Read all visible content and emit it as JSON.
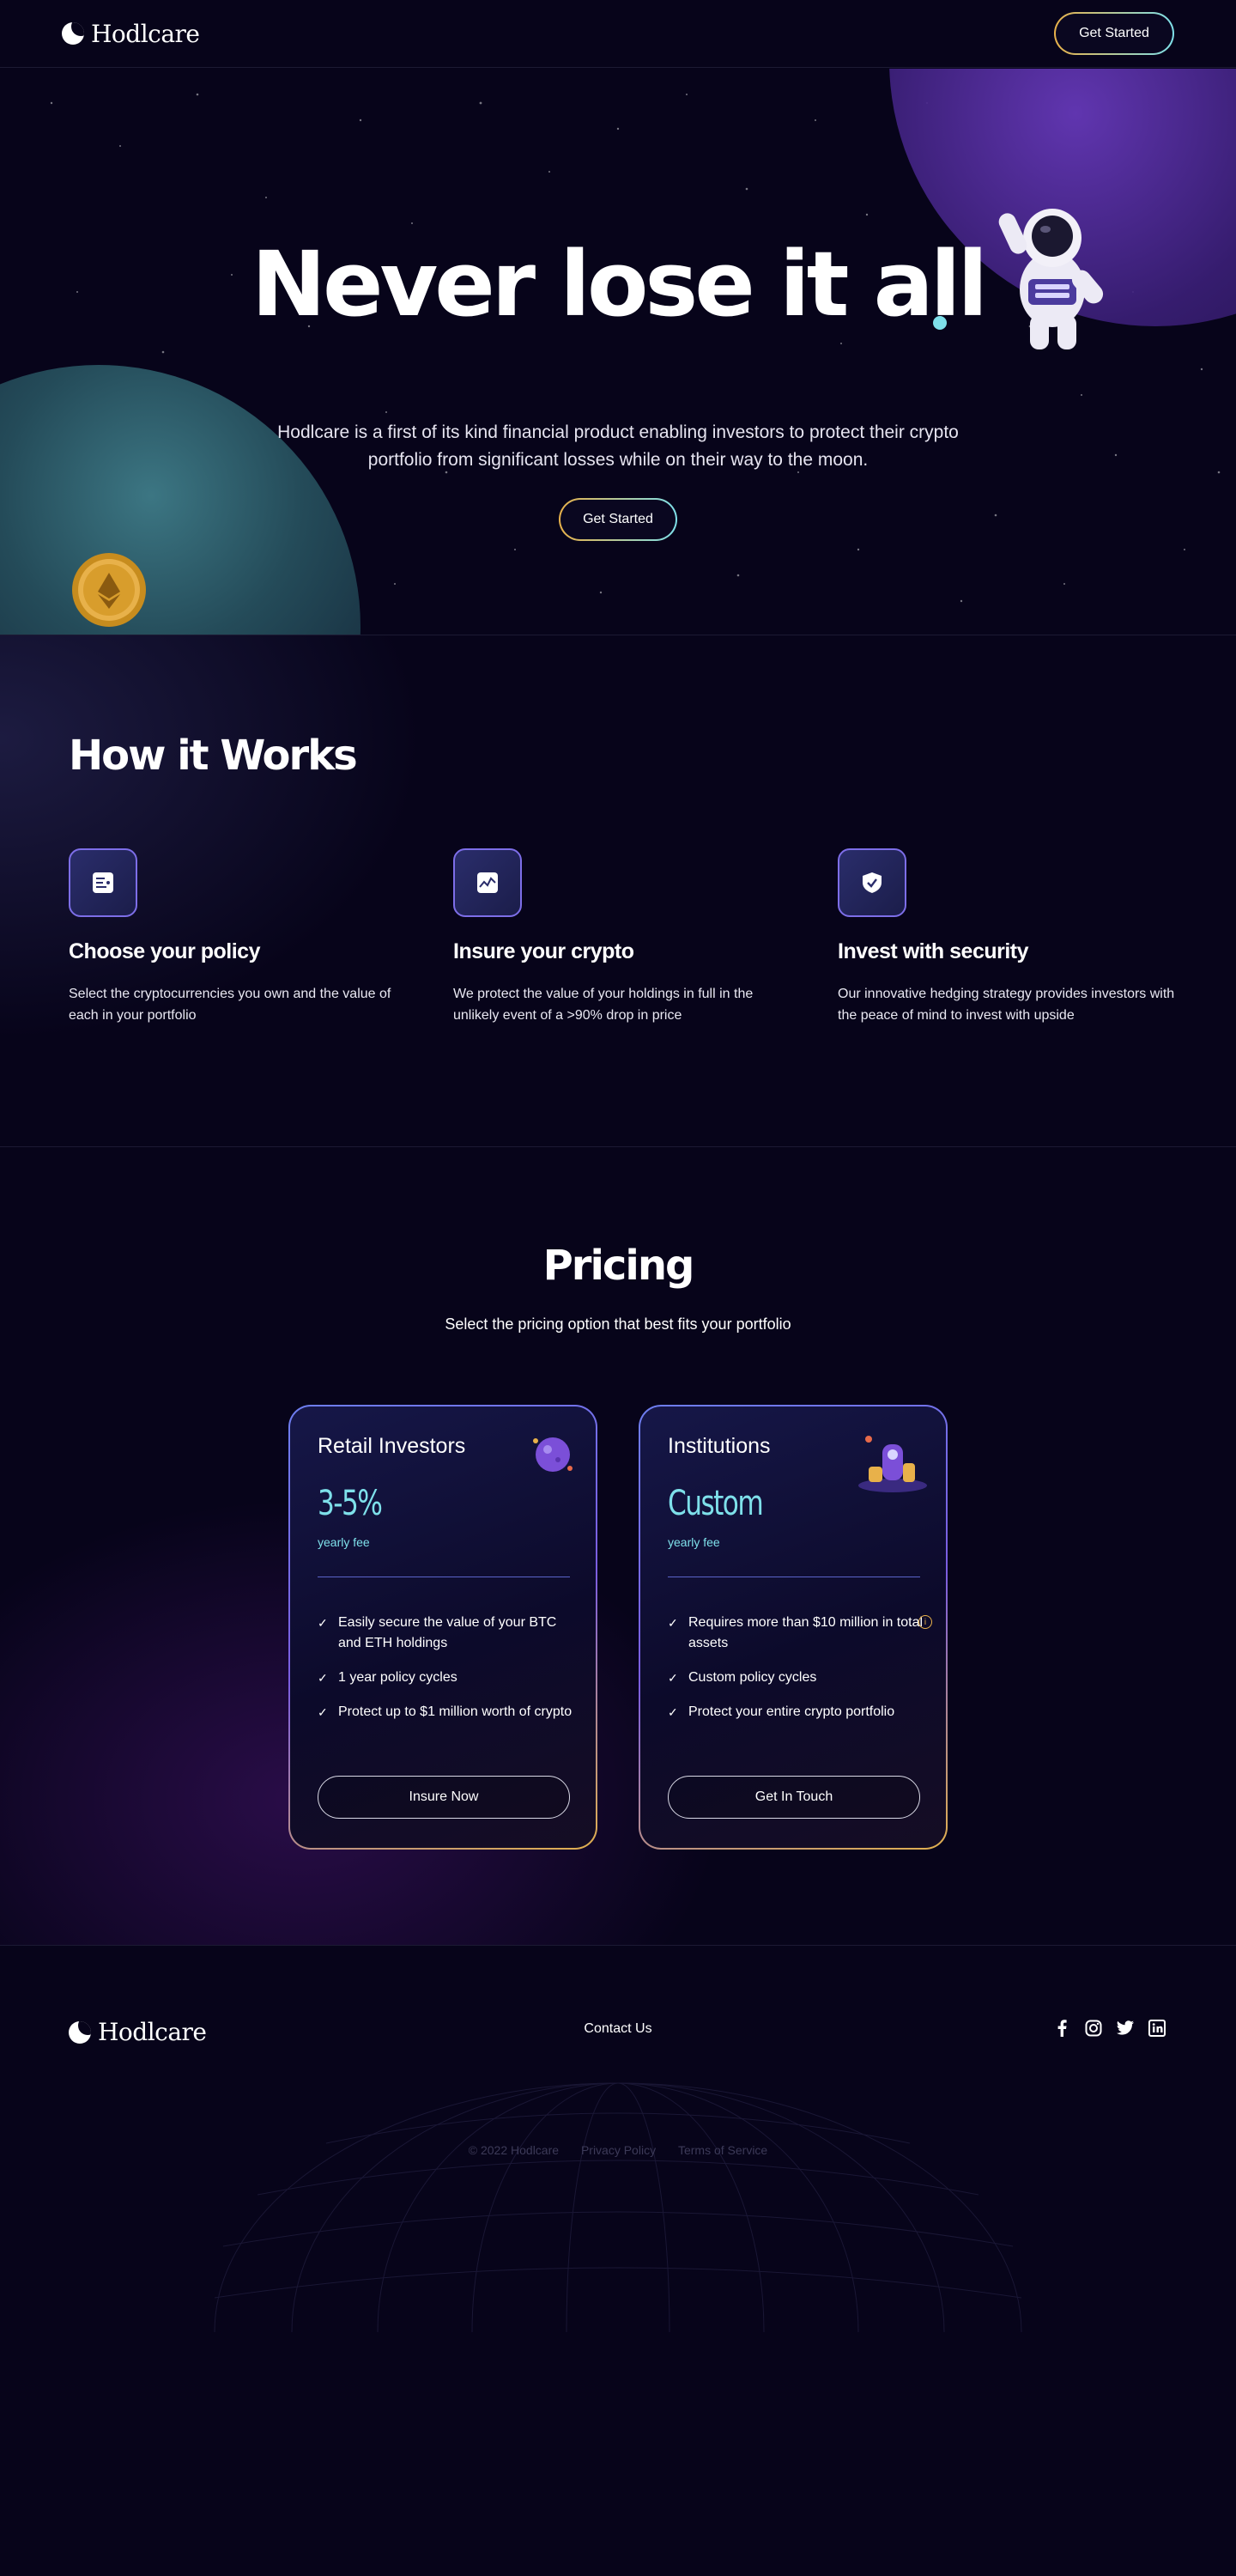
{
  "header": {
    "brand": "Hodlcare",
    "cta_label": "Get Started"
  },
  "hero": {
    "title": "Never lose it all",
    "subtitle": "Hodlcare is a first of its kind financial product enabling investors to protect their crypto portfolio from significant losses while on their way to the moon.",
    "cta_label": "Get Started"
  },
  "how": {
    "title": "How it Works",
    "features": [
      {
        "icon": "policy-icon",
        "title": "Choose your policy",
        "desc": "Select the cryptocurrencies you own and the value of each in your portfolio"
      },
      {
        "icon": "chart-icon",
        "title": "Insure your crypto",
        "desc": "We protect the value of your holdings in full in the unlikely event of a >90% drop in price"
      },
      {
        "icon": "shield-icon",
        "title": "Invest with security",
        "desc": "Our innovative hedging strategy provides investors with the peace of mind to invest with upside"
      }
    ]
  },
  "pricing": {
    "title": "Pricing",
    "subtitle": "Select the pricing option that best fits your portfolio",
    "plans": [
      {
        "name": "Retail Investors",
        "price": "3-5%",
        "period": "yearly fee",
        "features": [
          "Easily secure the value of your BTC and ETH holdings",
          "1 year policy cycles",
          "Protect up to $1 million worth of crypto"
        ],
        "cta": "Insure Now"
      },
      {
        "name": "Institutions",
        "price": "Custom",
        "period": "yearly fee",
        "features": [
          "Requires more than $10 million in total assets",
          "Custom policy cycles",
          "Protect your entire crypto portfolio"
        ],
        "cta": "Get In Touch"
      }
    ]
  },
  "footer": {
    "brand": "Hodlcare",
    "contact": "Contact Us",
    "socials": [
      "facebook-icon",
      "instagram-icon",
      "twitter-icon",
      "linkedin-icon"
    ],
    "copyright": "© 2022 Hodlcare",
    "privacy": "Privacy Policy",
    "terms": "Terms of Service"
  },
  "colors": {
    "background": "#07041a",
    "accent_cyan": "#7ee0ea",
    "accent_gold": "#e8b14a",
    "accent_purple": "#7d6ee8"
  }
}
